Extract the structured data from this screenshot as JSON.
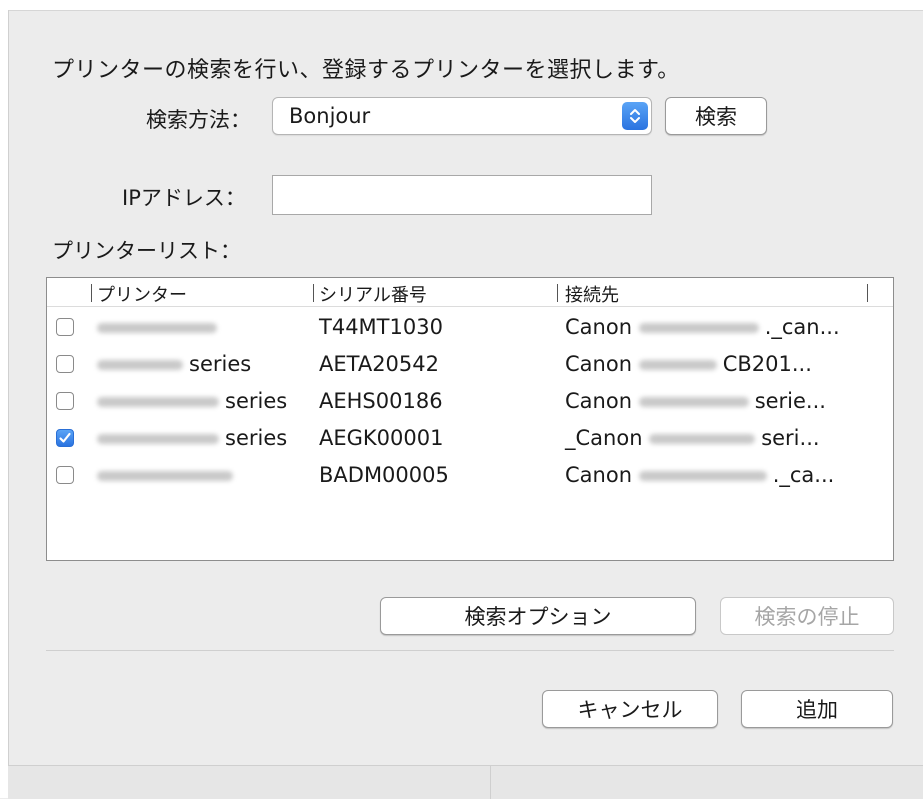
{
  "dialog": {
    "intro": "プリンターの検索を行い、登録するプリンターを選択します。",
    "search_method_label": "検索方法：",
    "search_method_value": "Bonjour",
    "search_button": "検索",
    "ip_label": "IPアドレス：",
    "ip_value": "",
    "printer_list_label": "プリンターリスト："
  },
  "table": {
    "columns": [
      "プリンター",
      "シリアル番号",
      "接続先"
    ],
    "rows": [
      {
        "checked": false,
        "printer": "",
        "serial": "T44MT1030",
        "dest_prefix": "Canon",
        "dest_suffix": "._can..."
      },
      {
        "checked": false,
        "printer": "series",
        "serial": "AETA20542",
        "dest_prefix": "Canon",
        "dest_suffix": "CB201..."
      },
      {
        "checked": false,
        "printer": "series",
        "serial": "AEHS00186",
        "dest_prefix": "Canon",
        "dest_suffix": "serie..."
      },
      {
        "checked": true,
        "printer": "series",
        "serial": "AEGK00001",
        "dest_prefix": "_Canon",
        "dest_suffix": "seri..."
      },
      {
        "checked": false,
        "printer": "",
        "serial": "BADM00005",
        "dest_prefix": "Canon",
        "dest_suffix": "._ca..."
      }
    ]
  },
  "buttons": {
    "search_options": "検索オプション",
    "stop_search": "検索の停止",
    "cancel": "キャンセル",
    "add": "追加"
  },
  "colors": {
    "accent": "#2a73e0",
    "disabled_text": "#a6a6a6"
  }
}
